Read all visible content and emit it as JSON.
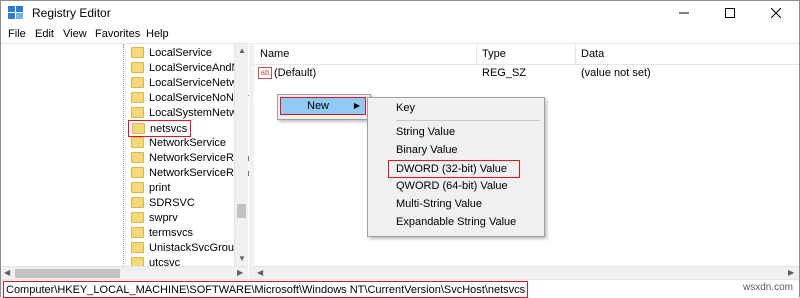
{
  "window": {
    "title": "Registry Editor",
    "controls": {
      "minimize": "—",
      "maximize": "☐",
      "close": "✕"
    }
  },
  "menu": [
    "File",
    "Edit",
    "View",
    "Favorites",
    "Help"
  ],
  "tree": {
    "items": [
      "LocalService",
      "LocalServiceAndNo",
      "LocalServiceNetwor",
      "LocalServiceNoNetv",
      "LocalSystemNetwor",
      "netsvcs",
      "NetworkService",
      "NetworkServiceRem",
      "NetworkServiceRem",
      "print",
      "SDRSVC",
      "swprv",
      "termsvcs",
      "UnistackSvcGroup",
      "utcsvc"
    ],
    "selected": "netsvcs"
  },
  "list": {
    "columns": [
      "Name",
      "Type",
      "Data"
    ],
    "rows": [
      {
        "name": "(Default)",
        "type": "REG_SZ",
        "data": "(value not set)",
        "icon": "string-value-icon",
        "icon_text": "ab"
      }
    ]
  },
  "context_menu": {
    "new_label": "New",
    "submenu": [
      "Key",
      "String Value",
      "Binary Value",
      "DWORD (32-bit) Value",
      "QWORD (64-bit) Value",
      "Multi-String Value",
      "Expandable String Value"
    ],
    "highlighted": "DWORD (32-bit) Value"
  },
  "status": {
    "path": "Computer\\HKEY_LOCAL_MACHINE\\SOFTWARE\\Microsoft\\Windows NT\\CurrentVersion\\SvcHost\\netsvcs"
  },
  "watermark": "wsxdn.com",
  "colors": {
    "highlight": "#e81123",
    "menu_selection": "#91c9f7",
    "folder": "#f4d97a"
  }
}
